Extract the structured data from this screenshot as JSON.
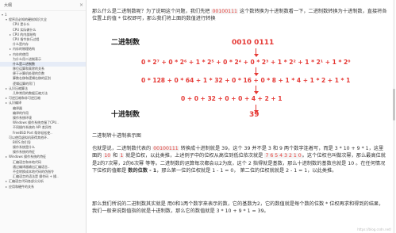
{
  "outline": {
    "title": "大纲",
    "items": [
      {
        "label": "1",
        "tri": "▾",
        "indent": 0
      },
      {
        "label": "程序员必知的硬核知识大全",
        "tri": "▾",
        "indent": 1
      },
      {
        "label": "CPU 是什么",
        "tri": "",
        "indent": 2
      },
      {
        "label": "CPU 实际做什么",
        "tri": "",
        "indent": 2
      },
      {
        "label": "CPU 的内部结构",
        "tri": "▸",
        "indent": 2
      },
      {
        "label": "CPU 指令执行过程",
        "tri": "",
        "indent": 2
      },
      {
        "label": "什么是内存",
        "tri": "",
        "indent": 2
      },
      {
        "label": "内存的物理结构",
        "tri": "▸",
        "indent": 2
      },
      {
        "label": "内存的使用",
        "tri": "▸",
        "indent": 2
      },
      {
        "label": "为什么用二进制表示",
        "tri": "",
        "indent": 2
      },
      {
        "label": "什么是二进制数",
        "tri": "",
        "indent": 2,
        "selected": true
      },
      {
        "label": "移位运算和乘除的关系",
        "tri": "",
        "indent": 2
      },
      {
        "label": "便于计算机处理的负数",
        "tri": "",
        "indent": 2
      },
      {
        "label": "算数右移和逻辑右移的区别",
        "tri": "",
        "indent": 2
      },
      {
        "label": "逻辑运算的窍门",
        "tri": "",
        "indent": 2
      },
      {
        "label": "认识压缩算法",
        "tri": "▸",
        "indent": 1
      },
      {
        "label": "几种常用的数据压缩方法",
        "tri": "",
        "indent": 2
      },
      {
        "label": "可逆压缩和非可逆压缩",
        "tri": "▸",
        "indent": 1
      },
      {
        "label": "认识编译",
        "tri": "▸",
        "indent": 1
      },
      {
        "label": "编译器",
        "tri": "",
        "indent": 2
      },
      {
        "label": "编译的作用",
        "tri": "",
        "indent": 2
      },
      {
        "label": "操作系统环境",
        "tri": "",
        "indent": 2
      },
      {
        "label": "Windows 操作系统克服了CPU..",
        "tri": "",
        "indent": 2
      },
      {
        "label": "不同操作系统的 API 差异性",
        "tri": "",
        "indent": 2
      },
      {
        "label": "FreeBSD Port 帮你轻松使..",
        "tri": "",
        "indent": 2
      },
      {
        "label": "可以使用虚拟机获得其他环..",
        "tri": "",
        "indent": 1
      },
      {
        "label": "BIOS 和引导",
        "tri": "",
        "indent": 2
      },
      {
        "label": "操作系统是什么",
        "tri": "",
        "indent": 2
      },
      {
        "label": "操作系统的特征",
        "tri": "",
        "indent": 2
      },
      {
        "label": "Windows 操作系统的特征",
        "tri": "▸",
        "indent": 1
      },
      {
        "label": "汇编语言和本地代码",
        "tri": "",
        "indent": 2
      },
      {
        "label": "通过编译器输出汇编语言..",
        "tri": "",
        "indent": 2
      },
      {
        "label": "不会转换成本地代码的伪指令",
        "tri": "",
        "indent": 2
      },
      {
        "label": "汇编语言的语法是 操作码 + 操..",
        "tri": "",
        "indent": 2
      },
      {
        "label": "汇编语言代码各部分分析",
        "tri": "▸",
        "indent": 1
      },
      {
        "label": "应用和硬件的关系",
        "tri": "▸",
        "indent": 1
      }
    ]
  },
  "doc": {
    "p1_a": "那么什么是二进制数呢？为了说明这个问题，我们先把 ",
    "p1_code": "00100111",
    "p1_b": " 这个数转换为十进制数看一下，二进制数转换为十进制数，直接将各位置上的值 * 位权即可，那么我们将上面的数值进行转换",
    "figure": {
      "binary_label": "二进制数",
      "decimal_label": "十进制数",
      "binary_value": "0010 0111",
      "line1": "0 * 2⁷ + 0 * 2⁶ + 1 * 2⁵ + 0 * 2⁴ + 0 * 2³ + 1 * 2² + 1 * 2¹ + 1 * 2⁰",
      "line2": "0 * 128 + 0 * 64 + 1 * 32 + 0 * 16 + 0 * 8 + 1 * 4 + 1 * 2 + 1 * 1",
      "line3": "0 + 0 + 32 + 0 + 0 + 4 + 2 + 1",
      "result": "39"
    },
    "caption": "二进制转十进制表示图",
    "p2_a": "也就是说，二进制数代表的 ",
    "p2_code": "00100111",
    "p2_b": " 转换成十进制就是 39，这个 39 并不是 3 和 9 两个数字连着写，而是 3 * 10 + 9 * 1，这里面的 ",
    "p2_c": "10",
    "p2_d": " 和 ",
    "p2_e": "1",
    "p2_f": " 就是位权，以此类推，上述例子中的位权从高位到低位依次就是 ",
    "p2_g": "7 6 5 4 3 2 1 0",
    "p2_h": "。这个位权也叫做次幂，那么最高位就是2的7次幂，2的6次幂 等等。二进制数的运算每次都会以2为底，这个 2 指得就是基数，那么十进制数的基数也就是 10 。在任何情况下位权的值都是 ",
    "p2_i": "数的位数 - 1",
    "p2_j": "，那么第一位的位权就是 1 - 1 = 0， 第二位的位权就就是 2 - 1 = 1，以此类推。",
    "p3": "那么我们所说的二进制数其实就是 用0和1两个数字来表示的数，它的基数为2，它的数值就是每个数的位数 * 位权再求和得到的结果，我们一般来说数值指的就是十进制数，那么它的数值就是 3 * 10 + 9 * 1 = 39。"
  },
  "watermark": "https://blog.csdn.net/"
}
